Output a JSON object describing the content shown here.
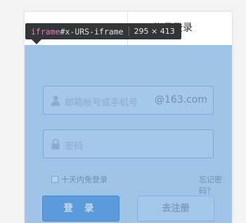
{
  "tabs": {
    "right": "帐号登录"
  },
  "tooltip": {
    "tag": "iframe",
    "selector": "#x-URS-iframe",
    "size": "295 × 413"
  },
  "form": {
    "email_placeholder": "邮箱帐号或手机号",
    "email_suffix": "@163.com",
    "password_placeholder": "密码",
    "remember_label": "十天内免登录",
    "forgot_label": "忘记密码？",
    "login_button": "登 录",
    "register_button": "去注册"
  },
  "icons": {
    "user": "user-icon",
    "lock": "lock-icon"
  },
  "colors": {
    "overlay": "#a0c4e8",
    "login_button": "#5b9bdc",
    "tooltip_bg": "#333639"
  }
}
